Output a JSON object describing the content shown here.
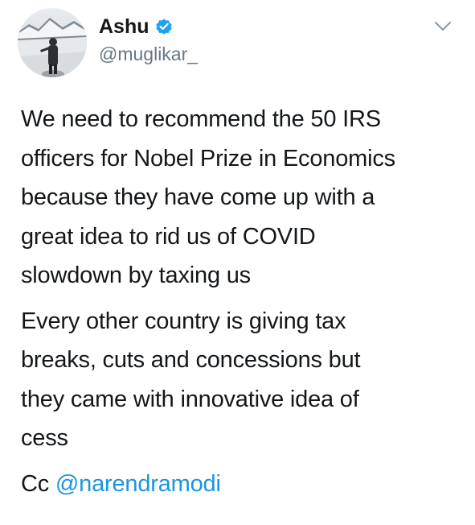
{
  "user": {
    "display_name": "Ashu",
    "handle": "@muglikar_",
    "verified": true,
    "verified_icon": "verified-badge-icon",
    "verified_color": "#1da1f2"
  },
  "tweet": {
    "paragraph_1": [
      "We need to recommend the 50 IRS",
      "officers for Nobel Prize in Economics",
      "because they have come up with a",
      "great idea to rid us of COVID",
      "slowdown by taxing us"
    ],
    "paragraph_2": [
      "Every other country is giving tax",
      "breaks, cuts and concessions but",
      "they came with innovative idea of",
      "cess"
    ],
    "cc_prefix": "Cc",
    "mention": "@narendramodi"
  },
  "colors": {
    "text": "#14171a",
    "secondary": "#657786",
    "link": "#1b95e0"
  },
  "icons": {
    "caret": "chevron-down-icon"
  }
}
